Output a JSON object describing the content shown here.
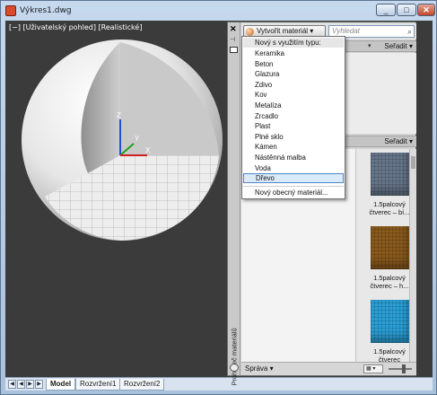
{
  "window": {
    "title": "Výkres1.dwg",
    "min": "_",
    "max": "□",
    "close": "✕"
  },
  "viewport": {
    "label": "[−] [Uživatelský pohled] [Realistické]",
    "axes": {
      "x": "X",
      "y": "Y",
      "z": "Z"
    }
  },
  "tabs": {
    "nav": [
      "◀",
      "◀",
      "▶",
      "▶"
    ],
    "items": [
      "Model",
      "Rozvržení1",
      "Rozvržení2"
    ]
  },
  "palette": {
    "side_title": "Prohlížeč materiálů",
    "strip_close": "✕",
    "strip_pin": "⊣",
    "create_button": "Vytvořit materiál",
    "create_arrow": "▾",
    "search_placeholder": "Vyhledat",
    "sort_label": "Seřadit",
    "sort_arrow": "▾",
    "chevron": "▾",
    "footer_label": "Správa",
    "footer_arrow": "▾",
    "view_toggle": "▦ ▾",
    "thumbnails": [
      {
        "caption": "1.5palcový čtverec – bí...",
        "color": "#66768a"
      },
      {
        "caption": "1.5palcový čtverec – h...",
        "color": "#8a5a1c"
      },
      {
        "caption": "1.5palcový čtverec",
        "color": "#2a9fd6"
      }
    ]
  },
  "dropdown": {
    "header": "Nový s využitím typu:",
    "items": [
      "Keramika",
      "Beton",
      "Glazura",
      "Zdivo",
      "Kov",
      "Metalíza",
      "Zrcadlo",
      "Plast",
      "Plné sklo",
      "Kámen",
      "Nástěnná malba",
      "Voda",
      "Dřevo"
    ],
    "hovered_item": "Dřevo",
    "footer_item": "Nový obecný materiál..."
  }
}
